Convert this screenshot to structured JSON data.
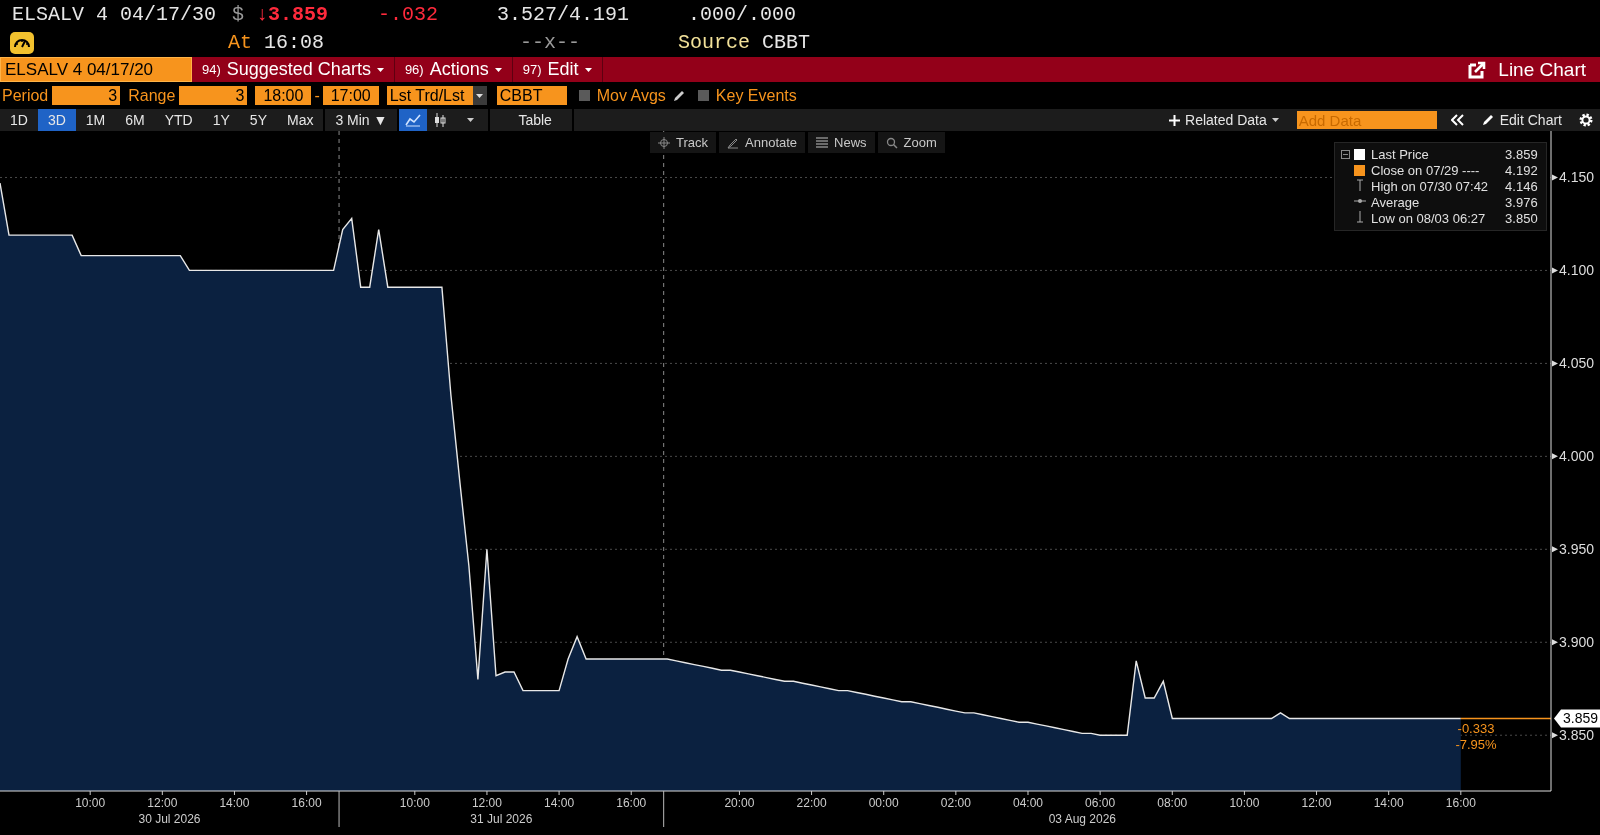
{
  "quote": {
    "ticker": "ELSALV 4 04/17/30",
    "currency": "$",
    "down": true,
    "last_price": "↓3.859",
    "change": "-.032",
    "bid_ask": "3.527/4.191",
    "sizes": ".000/.000",
    "time_label": "At",
    "time": "16:08",
    "size_ratio": "--x--",
    "source_label": "Source",
    "source": "CBBT"
  },
  "menubar": {
    "security_field": "ELSALV 4 04/17/20",
    "menus": [
      {
        "number": "94)",
        "label": "Suggested Charts"
      },
      {
        "number": "96)",
        "label": "Actions"
      },
      {
        "number": "97)",
        "label": "Edit"
      }
    ],
    "view": "Line Chart"
  },
  "params": {
    "period_label": "Period",
    "period": "3",
    "range_label": "Range",
    "range": "3",
    "start": "18:00",
    "separator": "-",
    "end": "17:00",
    "market": "Lst Trd/Lst",
    "source": "CBBT",
    "options": [
      {
        "kind": "editable",
        "label": "Mov Avgs",
        "checked": false
      },
      {
        "kind": "plain",
        "label": "Key Events",
        "checked": false
      }
    ]
  },
  "toolbar": {
    "ranges": [
      {
        "label": "1D",
        "selected": false
      },
      {
        "label": "3D",
        "selected": true
      },
      {
        "label": "1M",
        "selected": false
      },
      {
        "label": "6M",
        "selected": false
      },
      {
        "label": "YTD",
        "selected": false
      },
      {
        "label": "1Y",
        "selected": false
      },
      {
        "label": "5Y",
        "selected": false
      },
      {
        "label": "Max",
        "selected": false
      }
    ],
    "interval": "3 Min ▼",
    "chart_types": [
      {
        "kind": "line",
        "selected": true
      },
      {
        "kind": "candle",
        "selected": false
      }
    ],
    "table": "Table",
    "related": "Related Data",
    "add_data": {
      "placeholder": "Add Data"
    },
    "edit_chart": "Edit Chart"
  },
  "chart_tools": [
    {
      "kind": "track",
      "label": "Track"
    },
    {
      "kind": "annotate",
      "label": "Annotate"
    },
    {
      "kind": "news",
      "label": "News"
    },
    {
      "kind": "zoom",
      "label": "Zoom"
    }
  ],
  "legend": [
    {
      "kind": "square",
      "color": "#ffffff",
      "label": "Last Price",
      "value": "3.859"
    },
    {
      "kind": "square",
      "color": "#f7941d",
      "label": "Close on 07/29 ----",
      "value": "4.192"
    },
    {
      "kind": "high",
      "label": "High on 07/30 07:42",
      "value": "4.146"
    },
    {
      "kind": "average",
      "label": "Average",
      "value": "3.976"
    },
    {
      "kind": "low",
      "label": "Low on 08/03 06:27",
      "value": "3.850"
    }
  ],
  "chart": {
    "last_tag": "3.859",
    "change": "-0.333",
    "change_pct": "-7.95%",
    "chart_data": {
      "type": "area",
      "grid": true,
      "categories": [
        null,
        null,
        null,
        null,
        null,
        null,
        null,
        null,
        null,
        null,
        "10:00",
        null,
        null,
        null,
        null,
        null,
        null,
        null,
        "12:00",
        null,
        null,
        null,
        null,
        null,
        null,
        null,
        "14:00",
        null,
        null,
        null,
        null,
        null,
        null,
        null,
        "16:00",
        null,
        null,
        null,
        null,
        null,
        null,
        null,
        null,
        null,
        null,
        null,
        "10:00",
        null,
        null,
        null,
        null,
        null,
        null,
        null,
        "12:00",
        null,
        null,
        null,
        null,
        null,
        null,
        null,
        "14:00",
        null,
        null,
        null,
        null,
        null,
        null,
        null,
        "16:00",
        null,
        null,
        null,
        null,
        null,
        null,
        null,
        null,
        null,
        null,
        null,
        "20:00",
        null,
        null,
        null,
        null,
        null,
        null,
        null,
        "22:00",
        null,
        null,
        null,
        null,
        null,
        null,
        null,
        "00:00",
        null,
        null,
        null,
        null,
        null,
        null,
        null,
        "02:00",
        null,
        null,
        null,
        null,
        null,
        null,
        null,
        "04:00",
        null,
        null,
        null,
        null,
        null,
        null,
        null,
        "06:00",
        null,
        null,
        null,
        null,
        null,
        null,
        null,
        "08:00",
        null,
        null,
        null,
        null,
        null,
        null,
        null,
        "10:00",
        null,
        null,
        null,
        null,
        null,
        null,
        null,
        "12:00",
        null,
        null,
        null,
        null,
        null,
        null,
        null,
        "14:00",
        null,
        null,
        null,
        null,
        null,
        null,
        null,
        "16:00",
        null,
        null,
        null,
        null,
        null,
        null,
        null,
        null,
        null,
        null
      ],
      "ylim": [
        3.82,
        4.175
      ],
      "series": [
        {
          "color": "#e8e8e8",
          "values": [
            4.147,
            4.119,
            4.119,
            4.119,
            4.119,
            4.119,
            4.119,
            4.119,
            4.119,
            4.108,
            4.108,
            4.108,
            4.108,
            4.108,
            4.108,
            4.108,
            4.108,
            4.108,
            4.108,
            4.108,
            4.108,
            4.1,
            4.1,
            4.1,
            4.1,
            4.1,
            4.1,
            4.1,
            4.1,
            4.1,
            4.1,
            4.1,
            4.1,
            4.1,
            4.1,
            4.1,
            4.1,
            4.1,
            4.122,
            4.128,
            4.091,
            4.091,
            4.122,
            4.091,
            4.091,
            4.091,
            4.091,
            4.091,
            4.091,
            4.091,
            4.033,
            3.986,
            3.941,
            3.88,
            3.95,
            3.882,
            3.884,
            3.884,
            3.874,
            3.874,
            3.874,
            3.874,
            3.874,
            3.891,
            3.903,
            3.891,
            3.891,
            3.891,
            3.891,
            3.891,
            3.891,
            3.891,
            3.891,
            3.891,
            3.891,
            3.89,
            3.889,
            3.888,
            3.887,
            3.886,
            3.885,
            3.885,
            3.884,
            3.883,
            3.882,
            3.881,
            3.88,
            3.879,
            3.879,
            3.878,
            3.877,
            3.876,
            3.875,
            3.874,
            3.874,
            3.873,
            3.872,
            3.871,
            3.87,
            3.869,
            3.868,
            3.868,
            3.867,
            3.866,
            3.865,
            3.864,
            3.863,
            3.862,
            3.862,
            3.861,
            3.86,
            3.859,
            3.858,
            3.857,
            3.857,
            3.856,
            3.855,
            3.854,
            3.853,
            3.852,
            3.851,
            3.851,
            3.85,
            3.85,
            3.85,
            3.85,
            3.89,
            3.87,
            3.87,
            3.879,
            3.859,
            3.859,
            3.859,
            3.859,
            3.859,
            3.859,
            3.859,
            3.859,
            3.859,
            3.859,
            3.859,
            3.859,
            3.862,
            3.859,
            3.859,
            3.859,
            3.859,
            3.859,
            3.859,
            3.859,
            3.859,
            3.859,
            3.859,
            3.859,
            3.859,
            3.859,
            3.859,
            3.859,
            3.859,
            3.859,
            3.859,
            3.859,
            3.859,
            null,
            null,
            null,
            null,
            null,
            null,
            null,
            null,
            null,
            null
          ]
        }
      ],
      "yticks": [
        {
          "value": 3.85,
          "label": "3.850"
        },
        {
          "value": 3.9,
          "label": "3.900"
        },
        {
          "value": 3.95,
          "label": "3.950"
        },
        {
          "value": 4.0,
          "label": "4.000"
        },
        {
          "value": 4.05,
          "label": "4.050"
        },
        {
          "value": 4.1,
          "label": "4.100"
        },
        {
          "value": 4.15,
          "label": "4.150"
        }
      ],
      "annotations": [
        "30 Jul 2026",
        "31 Jul 2026",
        "03 Aug 2026"
      ]
    }
  }
}
